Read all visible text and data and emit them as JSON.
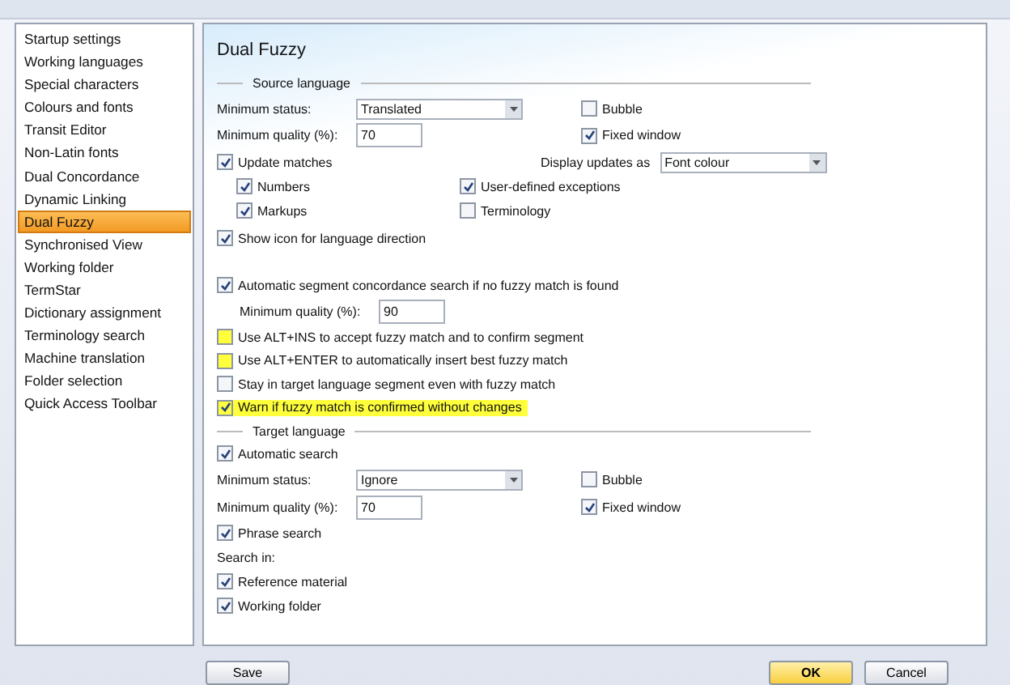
{
  "sidebar": {
    "items": [
      {
        "label": "Startup settings",
        "selected": false
      },
      {
        "label": "Working languages",
        "selected": false
      },
      {
        "label": "Special characters",
        "selected": false
      },
      {
        "label": "Colours and fonts",
        "selected": false
      },
      {
        "label": "Transit Editor",
        "selected": false
      },
      {
        "label": "Non-Latin fonts",
        "selected": false
      },
      {
        "label": "Dual Concordance",
        "selected": false
      },
      {
        "label": "Dynamic Linking",
        "selected": false
      },
      {
        "label": "Dual Fuzzy",
        "selected": true
      },
      {
        "label": "Synchronised View",
        "selected": false
      },
      {
        "label": "Working folder",
        "selected": false
      },
      {
        "label": "TermStar",
        "selected": false
      },
      {
        "label": "Dictionary assignment",
        "selected": false
      },
      {
        "label": "Terminology search",
        "selected": false
      },
      {
        "label": "Machine translation",
        "selected": false
      },
      {
        "label": "Folder selection",
        "selected": false
      },
      {
        "label": "Quick Access Toolbar",
        "selected": false
      }
    ]
  },
  "panel": {
    "title": "Dual Fuzzy",
    "source": {
      "legend": "Source language",
      "min_status": {
        "label": "Minimum status:",
        "value": "Translated"
      },
      "bubble": {
        "label": "Bubble",
        "checked": false
      },
      "min_quality": {
        "label": "Minimum quality (%):",
        "value": "70"
      },
      "fixed_window": {
        "label": "Fixed window",
        "checked": true
      },
      "update_matches": {
        "label": "Update matches",
        "checked": true
      },
      "display_updates": {
        "label": "Display updates as",
        "value": "Font colour"
      },
      "update_options": [
        {
          "label": "Numbers",
          "checked": true
        },
        {
          "label": "User-defined exceptions",
          "checked": true
        },
        {
          "label": "Markups",
          "checked": true
        },
        {
          "label": "Terminology",
          "checked": false
        }
      ],
      "show_icon": {
        "label": "Show icon for language direction",
        "checked": true
      }
    },
    "concordance": {
      "label": "Automatic segment concordance search if no fuzzy match is found",
      "checked": true
    },
    "concordance_quality": {
      "label": "Minimum quality (%):",
      "value": "90"
    },
    "options": [
      {
        "label": "Use ALT+INS to accept fuzzy match and to confirm segment",
        "checked": false,
        "box_highlighted": true,
        "row_highlighted": false
      },
      {
        "label": "Use ALT+ENTER to automatically insert best fuzzy match",
        "checked": false,
        "box_highlighted": true,
        "row_highlighted": false
      },
      {
        "label": "Stay in target language segment even with fuzzy match",
        "checked": false,
        "box_highlighted": false,
        "row_highlighted": false
      },
      {
        "label": "Warn if fuzzy match is confirmed without changes",
        "checked": true,
        "box_highlighted": true,
        "row_highlighted": true
      }
    ],
    "target": {
      "legend": "Target language",
      "automatic_search": {
        "label": "Automatic search",
        "checked": true
      },
      "min_status": {
        "label": "Minimum status:",
        "value": "Ignore"
      },
      "bubble": {
        "label": "Bubble",
        "checked": false
      },
      "min_quality": {
        "label": "Minimum quality (%):",
        "value": "70"
      },
      "fixed_window": {
        "label": "Fixed window",
        "checked": true
      },
      "phrase_search": {
        "label": "Phrase search",
        "checked": true
      },
      "search_in_label": "Search in:",
      "search_in": [
        {
          "label": "Reference material",
          "checked": true
        },
        {
          "label": "Working folder",
          "checked": true
        }
      ]
    }
  },
  "buttons": {
    "save": "Save",
    "ok": "OK",
    "cancel": "Cancel"
  }
}
